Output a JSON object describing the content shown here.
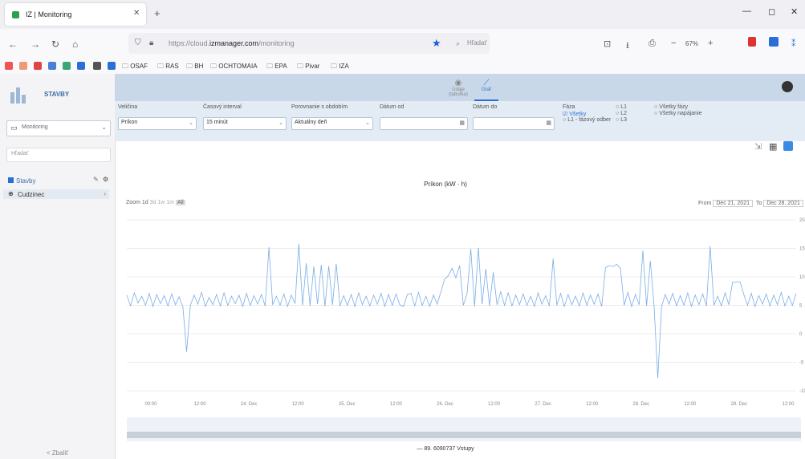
{
  "browser": {
    "tab_title": "IZ | Monitoring",
    "url_host": "izmanager.com",
    "url_prefix": "https://cloud.",
    "url_suffix": "/monitoring",
    "search_placeholder": "Hľadať",
    "zoom": "67%",
    "bookmarks": [
      "OSAF",
      "RAS",
      "BH",
      "OCHTOMAIA",
      "EPA",
      "Pivar",
      "IZA"
    ]
  },
  "sidebar": {
    "brand": "STAVBY",
    "location_select": "Monitoring",
    "search_placeholder": "Hľadať",
    "tree_root": "Stavby",
    "tree_item": "Cudzinec",
    "collapse": "< Zbaliť"
  },
  "header": {
    "tab_data_label": "Údaje (tabuľka)",
    "tab_graph_label": "Graf"
  },
  "filters": {
    "quantity_label": "Veličina",
    "quantity_value": "Príkon",
    "interval_label": "Časový interval",
    "interval_value": "15 minút",
    "shift_label": "Porovnanie s obdobím",
    "shift_value": "Aktuálny deň",
    "from_label": "Dátum od",
    "to_label": "Dátum do",
    "phase_label": "Fáza",
    "phase_options": [
      "Všetky",
      "L1 - fázový odber",
      "L1",
      "L2",
      "L3",
      "Všetky fázy",
      "Všetky napájanie"
    ]
  },
  "chart_data": {
    "type": "line",
    "title": "Príkon (kW · h)",
    "zoom_options": [
      "1d",
      "3d",
      "1w",
      "1m",
      "All"
    ],
    "range_from": "Dec 21, 2021",
    "range_to": "Dec 28, 2021",
    "x_ticks": [
      "00:00",
      "12:00",
      "24. Dec",
      "12:00",
      "25. Dec",
      "12:00",
      "26. Dec",
      "12:00",
      "27. Dec",
      "12:00",
      "28. Dec",
      "12:00",
      "29. Dec",
      "12:00"
    ],
    "y_ticks": [
      "20",
      "15",
      "10",
      "5",
      "0",
      "-5",
      "-10"
    ],
    "ylim": [
      -10,
      20
    ],
    "series": [
      {
        "name": "89. 6090737 Vstupy",
        "color": "#7aaee6",
        "values": [
          6.8,
          4.9,
          7.2,
          5.4,
          6.6,
          5.0,
          7.1,
          4.8,
          6.9,
          5.3,
          6.7,
          4.9,
          7.0,
          5.1,
          6.5,
          4.7,
          -3.2,
          5.0,
          6.8,
          5.2,
          7.3,
          4.8,
          6.4,
          5.1,
          6.9,
          4.9,
          7.2,
          5.0,
          6.6,
          5.3,
          6.8,
          4.8,
          7.1,
          5.0,
          6.7,
          5.2,
          6.9,
          4.9,
          15.2,
          5.1,
          6.6,
          5.0,
          7.0,
          4.8,
          6.8,
          5.3,
          15.8,
          5.0,
          12.4,
          4.9,
          11.8,
          5.2,
          12.1,
          4.8,
          11.9,
          5.1,
          12.3,
          4.9,
          6.7,
          5.0,
          6.9,
          4.8,
          7.2,
          5.1,
          6.6,
          4.9,
          6.8,
          5.2,
          7.1,
          4.8,
          6.9,
          5.0,
          7.0,
          5.1,
          4.8,
          6.9,
          7.1,
          4.9,
          7.3,
          5.0,
          6.6,
          4.8,
          6.8,
          5.2,
          7.4,
          9.6,
          10.2,
          11.5,
          9.8,
          12.0,
          5.0,
          7.1,
          14.9,
          4.8,
          15.1,
          5.2,
          11.4,
          4.9,
          10.8,
          5.1,
          7.4,
          5.0,
          7.2,
          4.9,
          6.8,
          5.1,
          7.0,
          5.0,
          6.6,
          4.8,
          7.2,
          5.2,
          6.7,
          4.9,
          13.2,
          5.0,
          7.1,
          4.8,
          6.9,
          5.1,
          6.6,
          4.9,
          7.2,
          5.0,
          6.8,
          5.2,
          7.0,
          4.8,
          11.6,
          12.0,
          11.8,
          12.2,
          11.5,
          5.0,
          7.3,
          4.8,
          6.9,
          5.1,
          14.6,
          4.9,
          12.8,
          5.0,
          -7.8,
          4.8,
          6.9,
          5.2,
          7.1,
          4.9,
          6.7,
          5.0,
          7.2,
          4.8,
          6.8,
          5.1,
          7.0,
          4.9,
          15.4,
          5.0,
          6.6,
          4.9,
          7.2,
          5.1,
          9.1,
          9.1,
          9.1,
          6.9,
          5.0,
          7.1,
          4.8,
          6.7,
          5.2,
          7.0,
          4.9,
          6.8,
          5.1,
          7.3,
          4.9,
          6.6,
          5.0,
          7.1
        ]
      }
    ]
  }
}
